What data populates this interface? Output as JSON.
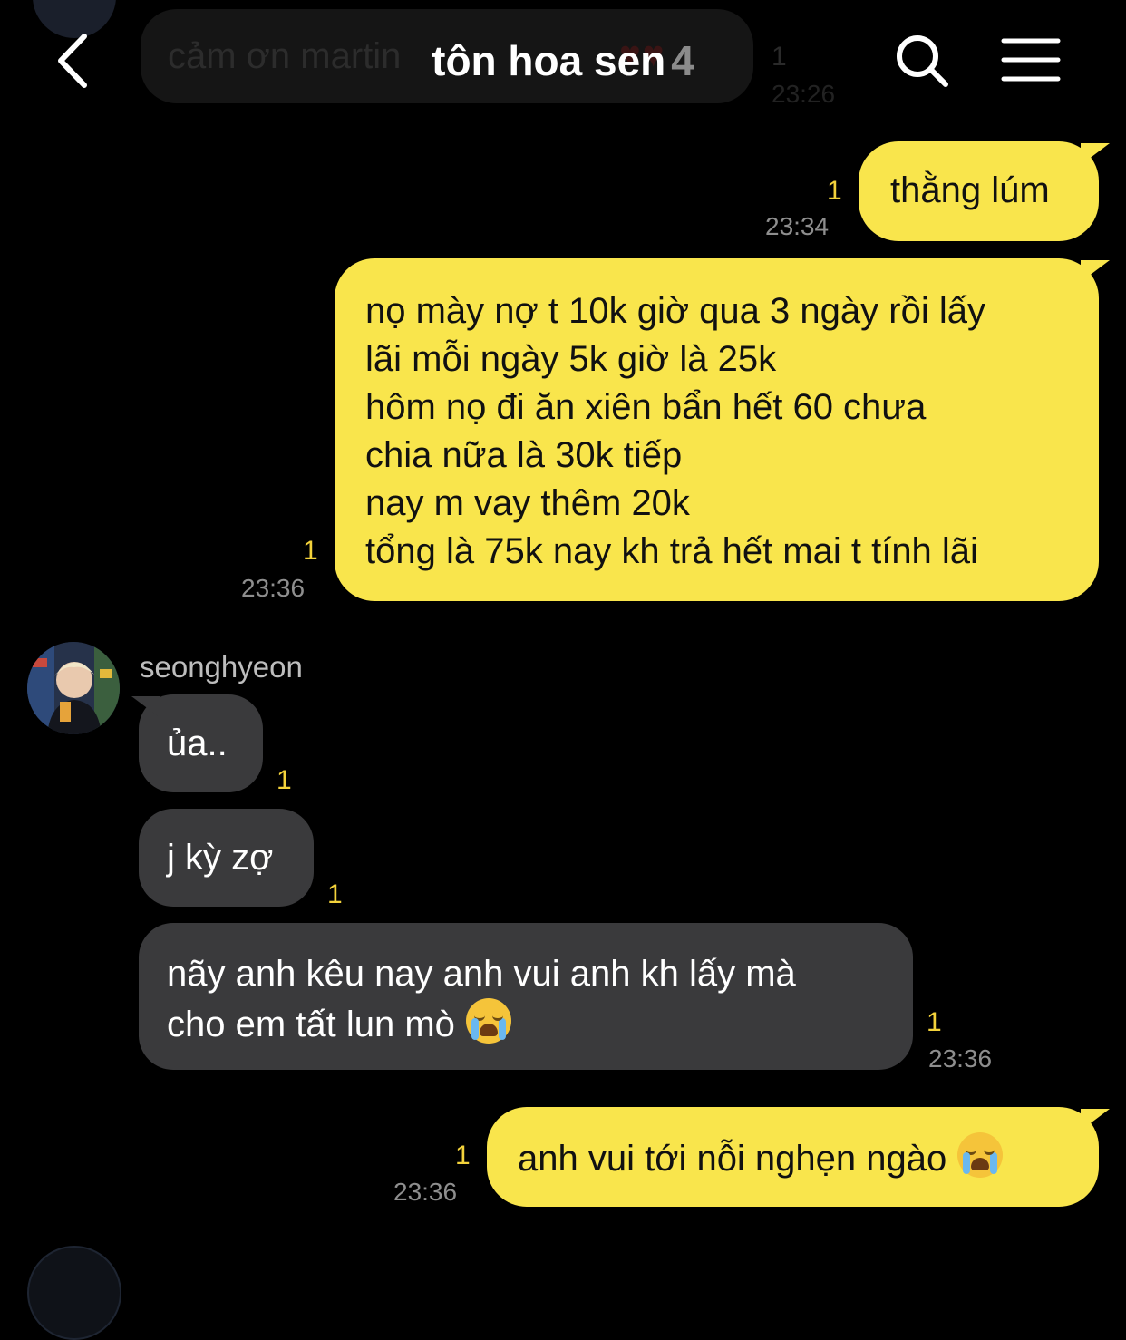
{
  "header": {
    "title": "tôn hoa sen",
    "member_count": "4",
    "back_icon": "chevron-left-icon",
    "search_icon": "search-icon",
    "menu_icon": "hamburger-menu-icon"
  },
  "previous_message": {
    "text": "cảm ơn martin",
    "unread": "1",
    "time": "23:26"
  },
  "messages": [
    {
      "side": "out",
      "lines": [
        "thằng lúm"
      ],
      "unread": "1",
      "time": "23:34"
    },
    {
      "side": "out",
      "lines": [
        "nọ mày nợ t 10k giờ qua 3 ngày rồi lấy",
        "lãi mỗi ngày 5k giờ là 25k",
        "hôm nọ đi ăn xiên bẩn hết 60 chưa",
        "chia nữa là 30k tiếp",
        "nay m vay thêm 20k",
        "tổng là 75k nay kh trả hết mai t tính lãi"
      ],
      "unread": "1",
      "time": "23:36"
    },
    {
      "side": "in",
      "sender": "seonghyeon",
      "lines": [
        "ủa.."
      ],
      "unread": "1"
    },
    {
      "side": "in",
      "lines": [
        "j kỳ zợ"
      ],
      "unread": "1"
    },
    {
      "side": "in",
      "lines": [
        "nãy anh kêu nay anh vui anh kh lấy mà",
        "cho em tất lun mò"
      ],
      "emoji": "loudly-crying-face",
      "unread": "1",
      "time": "23:36"
    },
    {
      "side": "out",
      "lines": [
        "anh vui tới nỗi nghẹn ngào"
      ],
      "emoji": "loudly-crying-face",
      "unread": "1",
      "time": "23:36"
    }
  ],
  "colors": {
    "background": "#000000",
    "outgoing_bubble": "#f9e54c",
    "incoming_bubble": "#3a3a3c",
    "unread_count": "#f3d23b",
    "timestamp": "#8e8e8e"
  }
}
